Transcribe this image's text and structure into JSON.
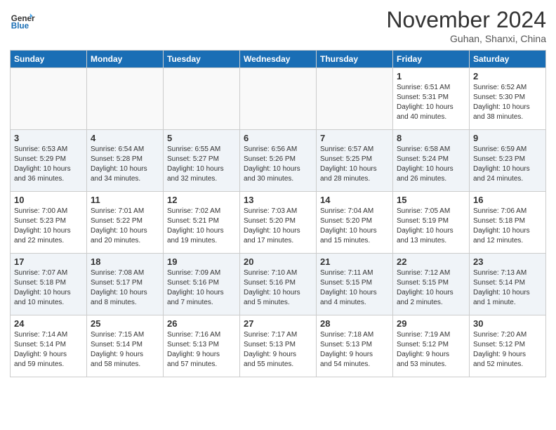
{
  "header": {
    "logo_line1": "General",
    "logo_line2": "Blue",
    "month": "November 2024",
    "location": "Guhan, Shanxi, China"
  },
  "weekdays": [
    "Sunday",
    "Monday",
    "Tuesday",
    "Wednesday",
    "Thursday",
    "Friday",
    "Saturday"
  ],
  "weeks": [
    [
      {
        "day": "",
        "info": ""
      },
      {
        "day": "",
        "info": ""
      },
      {
        "day": "",
        "info": ""
      },
      {
        "day": "",
        "info": ""
      },
      {
        "day": "",
        "info": ""
      },
      {
        "day": "1",
        "info": "Sunrise: 6:51 AM\nSunset: 5:31 PM\nDaylight: 10 hours\nand 40 minutes."
      },
      {
        "day": "2",
        "info": "Sunrise: 6:52 AM\nSunset: 5:30 PM\nDaylight: 10 hours\nand 38 minutes."
      }
    ],
    [
      {
        "day": "3",
        "info": "Sunrise: 6:53 AM\nSunset: 5:29 PM\nDaylight: 10 hours\nand 36 minutes."
      },
      {
        "day": "4",
        "info": "Sunrise: 6:54 AM\nSunset: 5:28 PM\nDaylight: 10 hours\nand 34 minutes."
      },
      {
        "day": "5",
        "info": "Sunrise: 6:55 AM\nSunset: 5:27 PM\nDaylight: 10 hours\nand 32 minutes."
      },
      {
        "day": "6",
        "info": "Sunrise: 6:56 AM\nSunset: 5:26 PM\nDaylight: 10 hours\nand 30 minutes."
      },
      {
        "day": "7",
        "info": "Sunrise: 6:57 AM\nSunset: 5:25 PM\nDaylight: 10 hours\nand 28 minutes."
      },
      {
        "day": "8",
        "info": "Sunrise: 6:58 AM\nSunset: 5:24 PM\nDaylight: 10 hours\nand 26 minutes."
      },
      {
        "day": "9",
        "info": "Sunrise: 6:59 AM\nSunset: 5:23 PM\nDaylight: 10 hours\nand 24 minutes."
      }
    ],
    [
      {
        "day": "10",
        "info": "Sunrise: 7:00 AM\nSunset: 5:23 PM\nDaylight: 10 hours\nand 22 minutes."
      },
      {
        "day": "11",
        "info": "Sunrise: 7:01 AM\nSunset: 5:22 PM\nDaylight: 10 hours\nand 20 minutes."
      },
      {
        "day": "12",
        "info": "Sunrise: 7:02 AM\nSunset: 5:21 PM\nDaylight: 10 hours\nand 19 minutes."
      },
      {
        "day": "13",
        "info": "Sunrise: 7:03 AM\nSunset: 5:20 PM\nDaylight: 10 hours\nand 17 minutes."
      },
      {
        "day": "14",
        "info": "Sunrise: 7:04 AM\nSunset: 5:20 PM\nDaylight: 10 hours\nand 15 minutes."
      },
      {
        "day": "15",
        "info": "Sunrise: 7:05 AM\nSunset: 5:19 PM\nDaylight: 10 hours\nand 13 minutes."
      },
      {
        "day": "16",
        "info": "Sunrise: 7:06 AM\nSunset: 5:18 PM\nDaylight: 10 hours\nand 12 minutes."
      }
    ],
    [
      {
        "day": "17",
        "info": "Sunrise: 7:07 AM\nSunset: 5:18 PM\nDaylight: 10 hours\nand 10 minutes."
      },
      {
        "day": "18",
        "info": "Sunrise: 7:08 AM\nSunset: 5:17 PM\nDaylight: 10 hours\nand 8 minutes."
      },
      {
        "day": "19",
        "info": "Sunrise: 7:09 AM\nSunset: 5:16 PM\nDaylight: 10 hours\nand 7 minutes."
      },
      {
        "day": "20",
        "info": "Sunrise: 7:10 AM\nSunset: 5:16 PM\nDaylight: 10 hours\nand 5 minutes."
      },
      {
        "day": "21",
        "info": "Sunrise: 7:11 AM\nSunset: 5:15 PM\nDaylight: 10 hours\nand 4 minutes."
      },
      {
        "day": "22",
        "info": "Sunrise: 7:12 AM\nSunset: 5:15 PM\nDaylight: 10 hours\nand 2 minutes."
      },
      {
        "day": "23",
        "info": "Sunrise: 7:13 AM\nSunset: 5:14 PM\nDaylight: 10 hours\nand 1 minute."
      }
    ],
    [
      {
        "day": "24",
        "info": "Sunrise: 7:14 AM\nSunset: 5:14 PM\nDaylight: 9 hours\nand 59 minutes."
      },
      {
        "day": "25",
        "info": "Sunrise: 7:15 AM\nSunset: 5:14 PM\nDaylight: 9 hours\nand 58 minutes."
      },
      {
        "day": "26",
        "info": "Sunrise: 7:16 AM\nSunset: 5:13 PM\nDaylight: 9 hours\nand 57 minutes."
      },
      {
        "day": "27",
        "info": "Sunrise: 7:17 AM\nSunset: 5:13 PM\nDaylight: 9 hours\nand 55 minutes."
      },
      {
        "day": "28",
        "info": "Sunrise: 7:18 AM\nSunset: 5:13 PM\nDaylight: 9 hours\nand 54 minutes."
      },
      {
        "day": "29",
        "info": "Sunrise: 7:19 AM\nSunset: 5:12 PM\nDaylight: 9 hours\nand 53 minutes."
      },
      {
        "day": "30",
        "info": "Sunrise: 7:20 AM\nSunset: 5:12 PM\nDaylight: 9 hours\nand 52 minutes."
      }
    ]
  ]
}
